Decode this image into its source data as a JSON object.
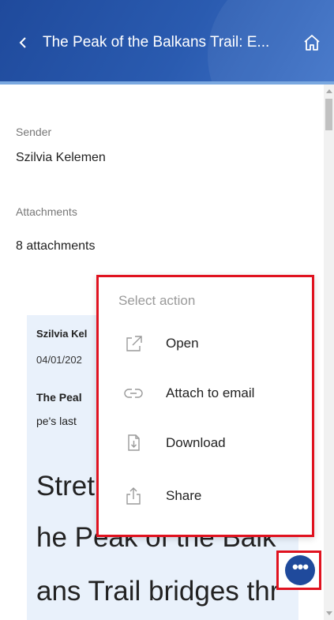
{
  "header": {
    "title": "The Peak of the Balkans Trail: E...",
    "back_icon": "chevron-left-icon",
    "home_icon": "home-icon",
    "colors": {
      "background": "#2a5bb0",
      "accent_border": "#7aa8e0"
    }
  },
  "details": {
    "sender_label": "Sender",
    "sender_value": "Szilvia Kelemen",
    "attachments_label": "Attachments",
    "attachments_value": "8 attachments"
  },
  "message": {
    "sender": "Szilvia Kel",
    "date": "04/01/202",
    "subject_line1": "The Peal",
    "subject_line2": "pe's last",
    "body_line1": "Stret",
    "body_line2": "he Peak of the Balk",
    "body_line3": "ans Trail bridges thr",
    "background_color": "#e9f1fb"
  },
  "action_menu": {
    "title": "Select action",
    "items": [
      {
        "label": "Open",
        "icon": "open-external-icon"
      },
      {
        "label": "Attach to email",
        "icon": "link-icon"
      },
      {
        "label": "Download",
        "icon": "download-file-icon"
      },
      {
        "label": "Share",
        "icon": "share-icon"
      }
    ],
    "highlight_color": "#e0121f"
  },
  "fab": {
    "icon": "more-horizontal-icon",
    "glyph": "•••"
  }
}
